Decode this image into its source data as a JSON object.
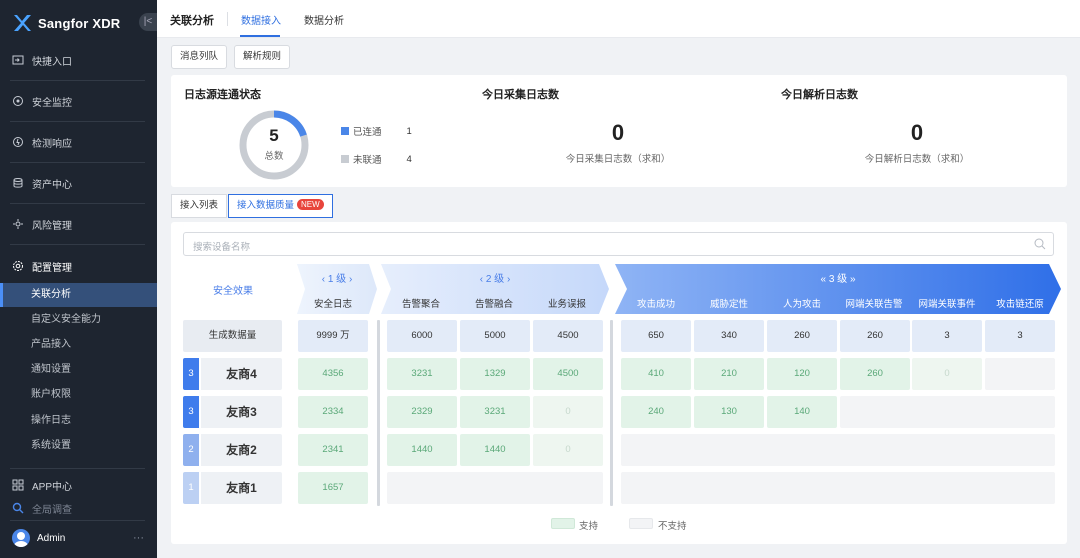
{
  "sidebar": {
    "brand": "Sangfor XDR",
    "collapse_glyph": "|<",
    "items": [
      {
        "label": "快捷入口",
        "icon": "shortcut-icon"
      },
      {
        "label": "安全监控",
        "icon": "monitor-icon"
      },
      {
        "label": "检测响应",
        "icon": "response-icon"
      },
      {
        "label": "资产中心",
        "icon": "database-icon"
      },
      {
        "label": "风险管理",
        "icon": "risk-icon"
      },
      {
        "label": "配置管理",
        "icon": "gear-icon"
      }
    ],
    "sub_items": [
      "关联分析",
      "自定义安全能力",
      "产品接入",
      "通知设置",
      "账户权限",
      "操作日志",
      "系统设置"
    ],
    "active_sub": "关联分析",
    "app_center": "APP中心",
    "global_search": "全局调查",
    "user": "Admin",
    "more": "···"
  },
  "topbar": {
    "title": "关联分析",
    "tabs": [
      "数据接入",
      "数据分析"
    ],
    "active_tab": "数据接入"
  },
  "sub_buttons": [
    "消息列队",
    "解析规则"
  ],
  "stats": {
    "connectivity": {
      "title": "日志源连通状态",
      "total": "5",
      "total_label": "总数",
      "connected_label": "已连通",
      "connected": 1,
      "disconnected_label": "未联通",
      "disconnected": 4
    },
    "collected": {
      "title": "今日采集日志数",
      "value": "0",
      "note": "今日采集日志数（求和）"
    },
    "parsed": {
      "title": "今日解析日志数",
      "value": "0",
      "note": "今日解析日志数（求和）"
    }
  },
  "tabs2": [
    "接入列表",
    "接入数据质量"
  ],
  "new_badge": "NEW",
  "search": {
    "placeholder": "搜索设备名称"
  },
  "matrix": {
    "effect_label": "安全效果",
    "levels": [
      {
        "label": "‹  1 级  ›"
      },
      {
        "label": "‹  2 级  ›"
      },
      {
        "label": "«  3 级  »"
      }
    ],
    "columns": [
      "安全日志",
      "告警聚合",
      "告警融合",
      "业务误报",
      "攻击成功",
      "威胁定性",
      "人为攻击",
      "网端关联告警",
      "网端关联事件",
      "攻击链还原"
    ],
    "total_label": "生成数据量",
    "totals": [
      "9999 万",
      "6000",
      "5000",
      "4500",
      "650",
      "340",
      "260",
      "260",
      "3",
      "3"
    ],
    "rows": [
      {
        "rank": "3",
        "name": "友商4",
        "values": [
          "4356",
          "3231",
          "1329",
          "4500",
          "410",
          "210",
          "120",
          "260",
          "0",
          null
        ]
      },
      {
        "rank": "3",
        "name": "友商3",
        "values": [
          "2334",
          "2329",
          "3231",
          "0",
          "240",
          "130",
          "140",
          null,
          null,
          null
        ]
      },
      {
        "rank": "2",
        "name": "友商2",
        "values": [
          "2341",
          "1440",
          "1440",
          "0",
          null,
          null,
          null,
          null,
          null,
          null
        ]
      },
      {
        "rank": "1",
        "name": "友商1",
        "values": [
          "1657",
          null,
          null,
          null,
          null,
          null,
          null,
          null,
          null,
          null
        ]
      }
    ],
    "legend": {
      "supported": "支持",
      "unsupported": "不支持"
    }
  },
  "colors": {
    "accent": "#2f6fe0",
    "connected": "#4a86e8",
    "disconnected": "#c8ccd2",
    "level3": "#3c7cf0",
    "supported": "#e2f3e8",
    "unsupported": "#f3f4f6"
  }
}
